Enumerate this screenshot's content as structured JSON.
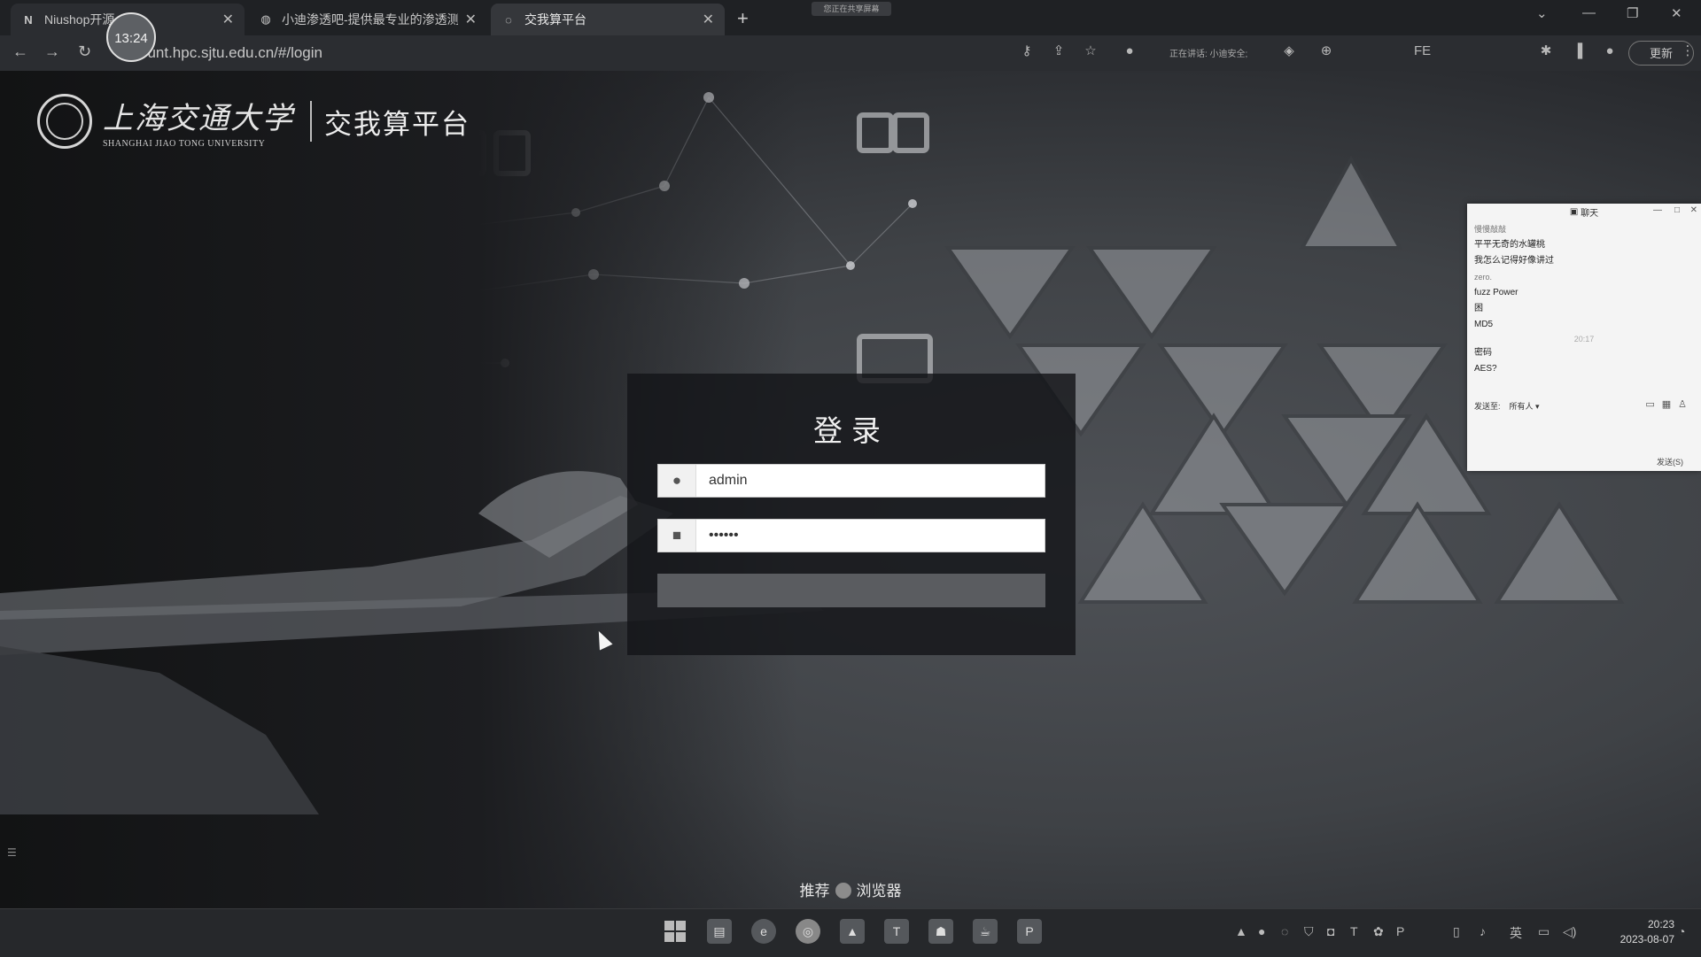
{
  "browser": {
    "tabs": [
      {
        "label": "Niushop开源",
        "favicon": "N"
      },
      {
        "label": "小迪渗透吧-提供最专业的渗透测",
        "favicon": "globe"
      },
      {
        "label": "交我算平台",
        "favicon": "circle"
      }
    ],
    "new_tab": "+",
    "share_banner": "您正在共享屏幕",
    "url": "ccount.hpc.sjtu.edu.cn/#/login",
    "timer": "13:24",
    "speaking": "正在讲话: 小迪安全;",
    "update_button": "更新",
    "toolbar_icons": [
      "key-icon",
      "share-icon",
      "star-icon",
      "extension-icon",
      "sidebar-icon",
      "profile-icon",
      "menu-icon"
    ]
  },
  "header": {
    "university_cn": "上海交通大学",
    "university_en": "SHANGHAI JIAO TONG UNIVERSITY",
    "platform_title": "交我算平台"
  },
  "login": {
    "title": "登录",
    "username_value": "admin",
    "password_value": "••••••",
    "submit_label": ""
  },
  "footer": {
    "recommend_prefix": "推荐",
    "recommend_suffix": "浏览器"
  },
  "chat": {
    "title": "聊天",
    "messages": [
      {
        "text": "慢慢敲敲",
        "faint": true
      },
      {
        "text": "平平无奇的水罐桃",
        "faint": false
      },
      {
        "text": "我怎么记得好像讲过",
        "faint": false
      },
      {
        "text": "zero.",
        "faint": true
      },
      {
        "text": "fuzz Power",
        "faint": false
      },
      {
        "text": "困",
        "faint": false
      },
      {
        "text": "MD5",
        "faint": false
      }
    ],
    "time": "20:17",
    "messages2": [
      {
        "text": "密码",
        "faint": false
      },
      {
        "text": "AES?",
        "faint": false
      }
    ],
    "send_to_label": "发送至:",
    "send_to_value": "所有人 ▾",
    "send_button": "发送(S)"
  },
  "taskbar": {
    "clock_time": "20:23",
    "clock_date": "2023-08-07",
    "ime": "英"
  }
}
